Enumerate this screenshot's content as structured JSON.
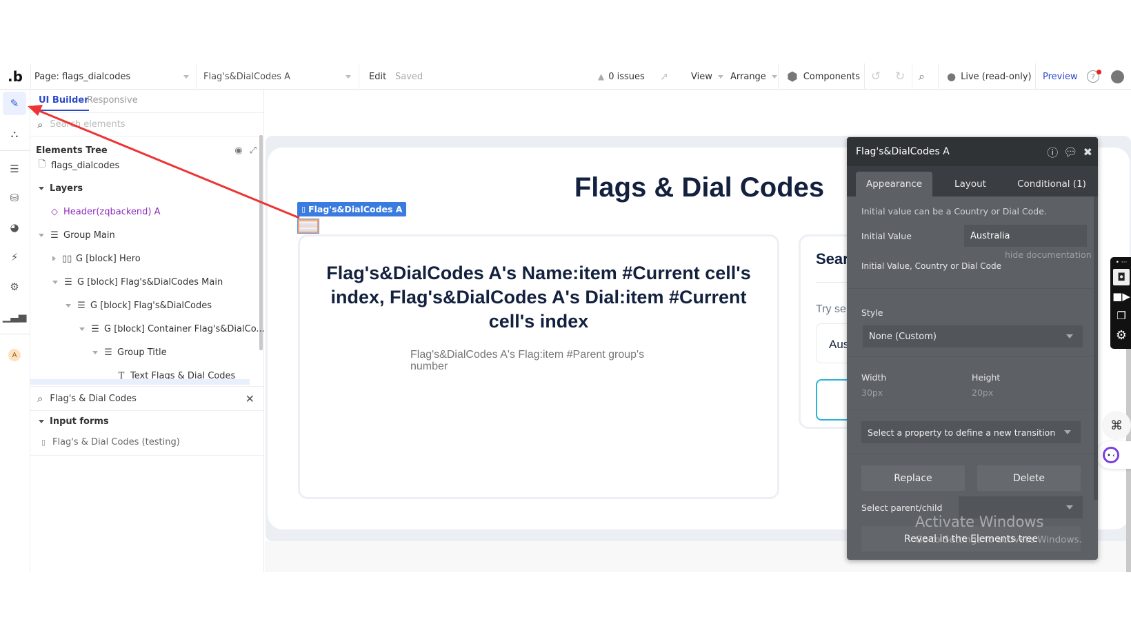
{
  "topbar": {
    "logo": ".b",
    "page_selector": "Page: flags_dialcodes",
    "element_selector": "Flag's&DialCodes A",
    "edit_label": "Edit",
    "saved_label": "Saved",
    "issues_label": "0 issues",
    "view_label": "View",
    "arrange_label": "Arrange",
    "components_label": "Components",
    "live_label": "Live (read-only)",
    "preview_label": "Preview"
  },
  "rail": {
    "items": [
      {
        "icon": "pencil-icon",
        "label": "Design",
        "active": true
      },
      {
        "icon": "workflow-icon",
        "label": "Workflow"
      },
      {
        "icon": "data-icon",
        "label": "Data"
      },
      {
        "icon": "database-icon",
        "label": "Database"
      },
      {
        "icon": "palette-icon",
        "label": "Styles"
      },
      {
        "icon": "plugin-icon",
        "label": "Plugins"
      },
      {
        "icon": "settings-icon",
        "label": "Settings"
      },
      {
        "icon": "analytics-icon",
        "label": "Logs"
      }
    ],
    "avatar_letter": "A"
  },
  "sidebar": {
    "tabs": [
      {
        "label": "UI Builder",
        "active": true
      },
      {
        "label": "Responsive",
        "active": false
      }
    ],
    "search_placeholder": "Search elements",
    "tree_title": "Elements Tree",
    "tree": [
      {
        "label": "flags_dialcodes",
        "icon": "page-icon",
        "depth": 0
      },
      {
        "label": "Layers",
        "expanded": true,
        "depth": 0
      },
      {
        "label": "Header(zqbackend) A",
        "icon": "reusable-diamond-icon",
        "depth": 1
      },
      {
        "label": "Group Main",
        "icon": "group-icon",
        "expanded": true,
        "depth": 1
      },
      {
        "label": "G [block] Hero",
        "icon": "columns-icon",
        "expanded": false,
        "depth": 2
      },
      {
        "label": "G [block] Flag's&DialCodes Main",
        "icon": "group-icon",
        "expanded": true,
        "depth": 2
      },
      {
        "label": "G [block] Flag's&DialCodes",
        "icon": "group-icon",
        "expanded": true,
        "depth": 3
      },
      {
        "label": "G [block] Container Flag's&DialCo...",
        "icon": "group-icon",
        "expanded": true,
        "depth": 4
      },
      {
        "label": "Group Title",
        "icon": "group-icon",
        "expanded": true,
        "depth": 5
      },
      {
        "label": "Text Flags & Dial Codes",
        "icon": "text-icon",
        "depth": 6
      }
    ],
    "element_search_value": "Flag's & Dial Codes",
    "results_group": "Input forms",
    "results": [
      {
        "label": "Flag's & Dial Codes (testing)",
        "icon": "mobile-icon"
      }
    ]
  },
  "canvas": {
    "page_title": "Flags & Dial Codes",
    "selected_tag": "Flag's&DialCodes A",
    "card_heading": "Flag's&DialCodes A's Name:item #Current cell's index, Flag's&DialCodes A's Dial:item #Current cell's index",
    "card_subtext": "Flag's&DialCodes A's Flag:item #Parent group's number",
    "search_card_title": "Sear",
    "search_card_hint": "Try se",
    "search_card_input": "Aus"
  },
  "panel": {
    "title": "Flag's&DialCodes A",
    "tabs": [
      {
        "label": "Appearance",
        "active": true
      },
      {
        "label": "Layout",
        "active": false
      },
      {
        "label": "Conditional (1)",
        "active": false
      }
    ],
    "doc_note": "Initial value can be a Country or Dial Code.",
    "initial_value_label": "Initial Value",
    "initial_value": "Australia",
    "hide_doc_link": "hide documentation",
    "initial_value_doc": "Initial Value, Country or Dial Code",
    "style_label": "Style",
    "style_value": "None (Custom)",
    "width_label": "Width",
    "width_value": "30px",
    "height_label": "Height",
    "height_value": "20px",
    "transition_placeholder": "Select a property to define a new transition",
    "replace_label": "Replace",
    "delete_label": "Delete",
    "parent_child_label": "Select parent/child",
    "parent_child_value": "",
    "reveal_label": "Reveal in the Elements tree"
  },
  "os_overlay": {
    "watermark_title": "Activate Windows",
    "watermark_sub": "Go to Settings to activate Windows."
  },
  "colors": {
    "accent_blue": "#2c49c8",
    "tag_blue": "#3a7be0",
    "reusable_purple": "#8d2cbe",
    "annotation_red": "#ee3333",
    "panel_bg": "#5d6166",
    "panel_header": "#2f3336",
    "title_navy": "#13213f"
  }
}
